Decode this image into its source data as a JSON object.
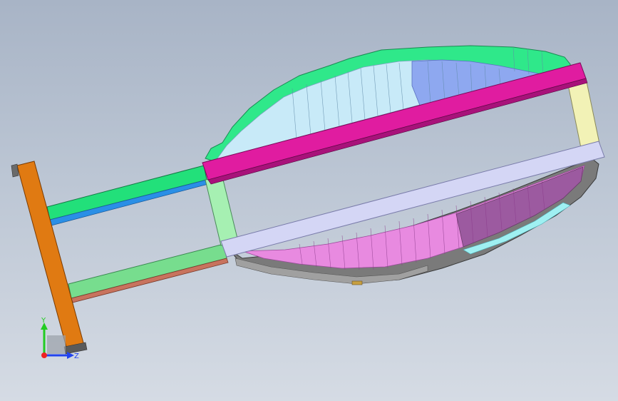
{
  "viewport": {
    "background_top": "#a8b4c6",
    "background_bottom": "#d5dbe4"
  },
  "model": {
    "part_colors": {
      "end_bar": "#e07a12",
      "upper_rail": "#22e07a",
      "upper_rail_strip": "#2a8fe6",
      "lower_rail": "#77dd8e",
      "lower_rail_strip": "#c8735e",
      "top_beam": "#e01ca0",
      "bottom_beam": "#d4d6f5",
      "left_post": "#a6f0b2",
      "right_post": "#f2f2b6",
      "upper_shell_rim": "#2fe88a",
      "upper_shell_face": "#c8eaf8",
      "upper_shell_blue": "#8ea8f0",
      "lower_shell_face": "#e88ae0",
      "lower_shell_dark": "#9c5aa0",
      "lower_shell_base": "#7a7a7a"
    }
  },
  "triad": {
    "y_label": "Y",
    "z_label": "Z",
    "y_color": "#22cc22",
    "z_color": "#2244ee",
    "x_color": "#ee2222"
  }
}
